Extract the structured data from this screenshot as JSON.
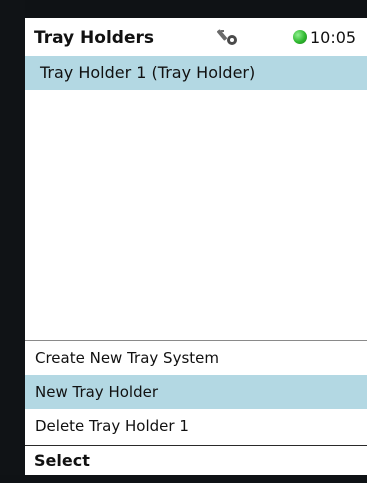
{
  "header": {
    "title": "Tray Holders",
    "key_icon": "key-icon",
    "status_color": "#2fb82f",
    "time": "10:05"
  },
  "list": {
    "items": [
      {
        "label": "Tray Holder 1 (Tray Holder)",
        "selected": true
      }
    ]
  },
  "menu": {
    "items": [
      {
        "label": "Create New Tray System"
      },
      {
        "label": "New Tray Holder",
        "highlighted": true
      },
      {
        "label": "Delete Tray Holder 1"
      }
    ]
  },
  "softkey": {
    "label": "Select"
  },
  "colors": {
    "selection": "#b3d8e3",
    "bezel": "#0f1215"
  }
}
